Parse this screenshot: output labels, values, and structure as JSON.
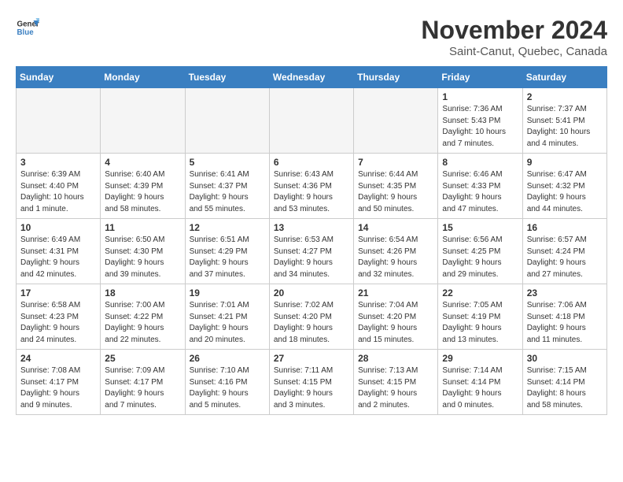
{
  "logo": {
    "line1": "General",
    "line2": "Blue"
  },
  "title": "November 2024",
  "location": "Saint-Canut, Quebec, Canada",
  "weekdays": [
    "Sunday",
    "Monday",
    "Tuesday",
    "Wednesday",
    "Thursday",
    "Friday",
    "Saturday"
  ],
  "weeks": [
    [
      {
        "day": "",
        "info": ""
      },
      {
        "day": "",
        "info": ""
      },
      {
        "day": "",
        "info": ""
      },
      {
        "day": "",
        "info": ""
      },
      {
        "day": "",
        "info": ""
      },
      {
        "day": "1",
        "info": "Sunrise: 7:36 AM\nSunset: 5:43 PM\nDaylight: 10 hours\nand 7 minutes."
      },
      {
        "day": "2",
        "info": "Sunrise: 7:37 AM\nSunset: 5:41 PM\nDaylight: 10 hours\nand 4 minutes."
      }
    ],
    [
      {
        "day": "3",
        "info": "Sunrise: 6:39 AM\nSunset: 4:40 PM\nDaylight: 10 hours\nand 1 minute."
      },
      {
        "day": "4",
        "info": "Sunrise: 6:40 AM\nSunset: 4:39 PM\nDaylight: 9 hours\nand 58 minutes."
      },
      {
        "day": "5",
        "info": "Sunrise: 6:41 AM\nSunset: 4:37 PM\nDaylight: 9 hours\nand 55 minutes."
      },
      {
        "day": "6",
        "info": "Sunrise: 6:43 AM\nSunset: 4:36 PM\nDaylight: 9 hours\nand 53 minutes."
      },
      {
        "day": "7",
        "info": "Sunrise: 6:44 AM\nSunset: 4:35 PM\nDaylight: 9 hours\nand 50 minutes."
      },
      {
        "day": "8",
        "info": "Sunrise: 6:46 AM\nSunset: 4:33 PM\nDaylight: 9 hours\nand 47 minutes."
      },
      {
        "day": "9",
        "info": "Sunrise: 6:47 AM\nSunset: 4:32 PM\nDaylight: 9 hours\nand 44 minutes."
      }
    ],
    [
      {
        "day": "10",
        "info": "Sunrise: 6:49 AM\nSunset: 4:31 PM\nDaylight: 9 hours\nand 42 minutes."
      },
      {
        "day": "11",
        "info": "Sunrise: 6:50 AM\nSunset: 4:30 PM\nDaylight: 9 hours\nand 39 minutes."
      },
      {
        "day": "12",
        "info": "Sunrise: 6:51 AM\nSunset: 4:29 PM\nDaylight: 9 hours\nand 37 minutes."
      },
      {
        "day": "13",
        "info": "Sunrise: 6:53 AM\nSunset: 4:27 PM\nDaylight: 9 hours\nand 34 minutes."
      },
      {
        "day": "14",
        "info": "Sunrise: 6:54 AM\nSunset: 4:26 PM\nDaylight: 9 hours\nand 32 minutes."
      },
      {
        "day": "15",
        "info": "Sunrise: 6:56 AM\nSunset: 4:25 PM\nDaylight: 9 hours\nand 29 minutes."
      },
      {
        "day": "16",
        "info": "Sunrise: 6:57 AM\nSunset: 4:24 PM\nDaylight: 9 hours\nand 27 minutes."
      }
    ],
    [
      {
        "day": "17",
        "info": "Sunrise: 6:58 AM\nSunset: 4:23 PM\nDaylight: 9 hours\nand 24 minutes."
      },
      {
        "day": "18",
        "info": "Sunrise: 7:00 AM\nSunset: 4:22 PM\nDaylight: 9 hours\nand 22 minutes."
      },
      {
        "day": "19",
        "info": "Sunrise: 7:01 AM\nSunset: 4:21 PM\nDaylight: 9 hours\nand 20 minutes."
      },
      {
        "day": "20",
        "info": "Sunrise: 7:02 AM\nSunset: 4:20 PM\nDaylight: 9 hours\nand 18 minutes."
      },
      {
        "day": "21",
        "info": "Sunrise: 7:04 AM\nSunset: 4:20 PM\nDaylight: 9 hours\nand 15 minutes."
      },
      {
        "day": "22",
        "info": "Sunrise: 7:05 AM\nSunset: 4:19 PM\nDaylight: 9 hours\nand 13 minutes."
      },
      {
        "day": "23",
        "info": "Sunrise: 7:06 AM\nSunset: 4:18 PM\nDaylight: 9 hours\nand 11 minutes."
      }
    ],
    [
      {
        "day": "24",
        "info": "Sunrise: 7:08 AM\nSunset: 4:17 PM\nDaylight: 9 hours\nand 9 minutes."
      },
      {
        "day": "25",
        "info": "Sunrise: 7:09 AM\nSunset: 4:17 PM\nDaylight: 9 hours\nand 7 minutes."
      },
      {
        "day": "26",
        "info": "Sunrise: 7:10 AM\nSunset: 4:16 PM\nDaylight: 9 hours\nand 5 minutes."
      },
      {
        "day": "27",
        "info": "Sunrise: 7:11 AM\nSunset: 4:15 PM\nDaylight: 9 hours\nand 3 minutes."
      },
      {
        "day": "28",
        "info": "Sunrise: 7:13 AM\nSunset: 4:15 PM\nDaylight: 9 hours\nand 2 minutes."
      },
      {
        "day": "29",
        "info": "Sunrise: 7:14 AM\nSunset: 4:14 PM\nDaylight: 9 hours\nand 0 minutes."
      },
      {
        "day": "30",
        "info": "Sunrise: 7:15 AM\nSunset: 4:14 PM\nDaylight: 8 hours\nand 58 minutes."
      }
    ]
  ]
}
